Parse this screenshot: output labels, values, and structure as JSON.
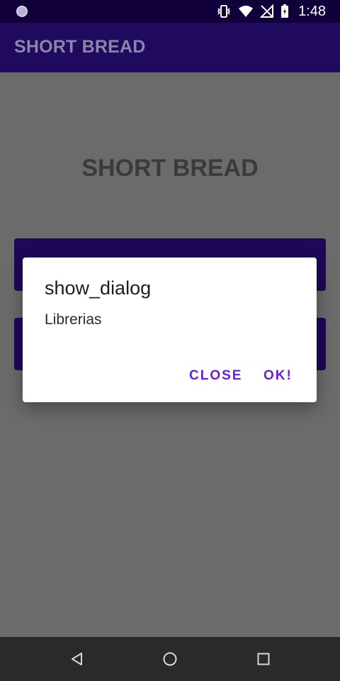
{
  "status_bar": {
    "time": "1:48",
    "icons": [
      "notification-dot-icon",
      "vibrate-icon",
      "wifi-icon",
      "no-signal-icon",
      "battery-charging-icon"
    ]
  },
  "app_bar": {
    "title": "SHORT BREAD"
  },
  "main": {
    "heading": "SHORT BREAD"
  },
  "dialog": {
    "title": "show_dialog",
    "message": "Librerias",
    "close_label": "CLOSE",
    "ok_label": "OK!"
  },
  "nav_bar": {
    "icons": [
      "back-icon",
      "home-icon",
      "recents-icon"
    ]
  },
  "colors": {
    "app_bar": "#1f0a5e",
    "status_bar": "#12003a",
    "accent": "#6a1ed8",
    "scrim": "#6b6b6b"
  }
}
